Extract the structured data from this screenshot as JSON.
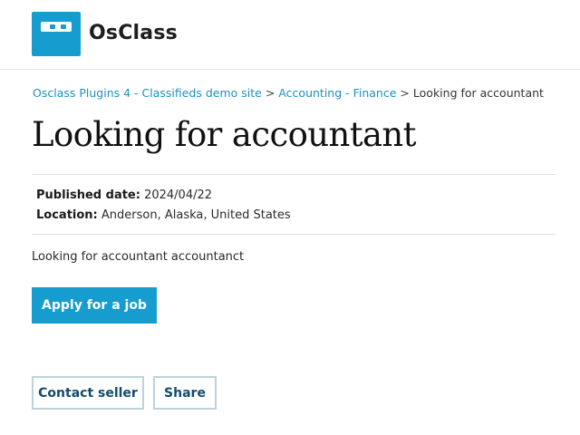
{
  "brand": {
    "name": "OsClass",
    "logo_color": "#169ccf"
  },
  "breadcrumb": {
    "items": [
      {
        "label": "Osclass Plugins 4 - Classifieds demo site",
        "link": true
      },
      {
        "label": "Accounting - Finance",
        "link": true
      },
      {
        "label": "Looking for accountant",
        "link": false
      }
    ],
    "separator": ">"
  },
  "listing": {
    "title": "Looking for accountant",
    "published_label": "Published date:",
    "published_value": "2024/04/22",
    "location_label": "Location:",
    "location_value": "Anderson, Alaska, United States",
    "description": "Looking for accountant accountanct"
  },
  "actions": {
    "apply_label": "Apply for a job",
    "contact_label": "Contact seller",
    "share_label": "Share"
  },
  "colors": {
    "accent": "#169ccf",
    "link": "#1e8fc0",
    "outline_border": "#bcd3de",
    "outline_text": "#124b6e"
  }
}
